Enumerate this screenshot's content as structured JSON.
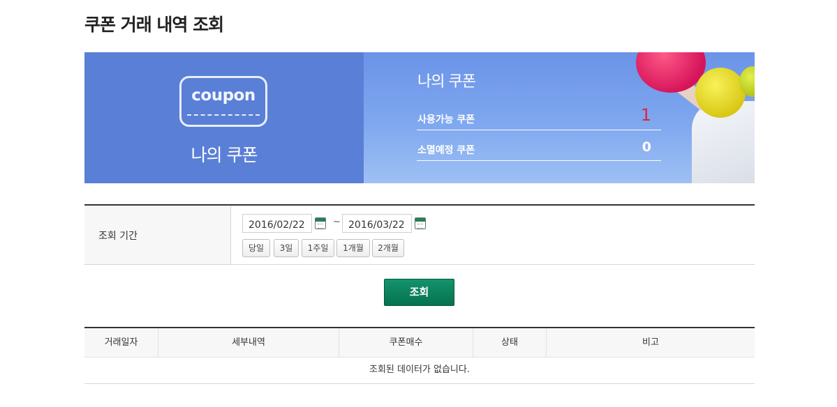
{
  "page": {
    "title": "쿠폰 거래 내역 조회"
  },
  "banner": {
    "icon_text": "coupon",
    "left_label": "나의 쿠폰",
    "right_title": "나의 쿠폰",
    "stats": [
      {
        "label": "사용가능 쿠폰",
        "value": "1",
        "color": "#e2233a"
      },
      {
        "label": "소멸예정 쿠폰",
        "value": "0",
        "color": "#ffffff"
      }
    ],
    "colors": {
      "left_bg": "#5a7fd6",
      "right_bg": "#7fa8ef"
    }
  },
  "search": {
    "label": "조회 기간",
    "start_date": "2016/02/22",
    "end_date": "2016/03/22",
    "separator": "~",
    "quick_ranges": [
      "당일",
      "3일",
      "1주일",
      "1개월",
      "2개월"
    ],
    "submit_label": "조회",
    "submit_color": "#0b7f5c"
  },
  "results": {
    "columns": [
      "거래일자",
      "세부내역",
      "쿠폰매수",
      "상태",
      "비고"
    ],
    "empty_message": "조회된 데이터가 없습니다."
  }
}
